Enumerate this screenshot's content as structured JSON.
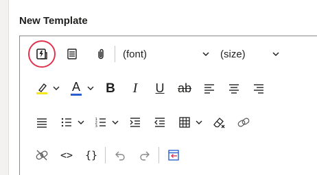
{
  "panel": {
    "title": "New Template"
  },
  "toolbar": {
    "font_select": {
      "value": "(font)"
    },
    "size_select": {
      "value": "(size)"
    },
    "bold_label": "B",
    "italic_label": "I",
    "underline_label": "U",
    "strikethrough_label": "ab",
    "font_color_label": "A",
    "highlight_color": "#f6e61e",
    "font_color": "#2b5fd0",
    "code_label": "<>",
    "braces_label": "{}",
    "accent_color": "#e0334d"
  }
}
